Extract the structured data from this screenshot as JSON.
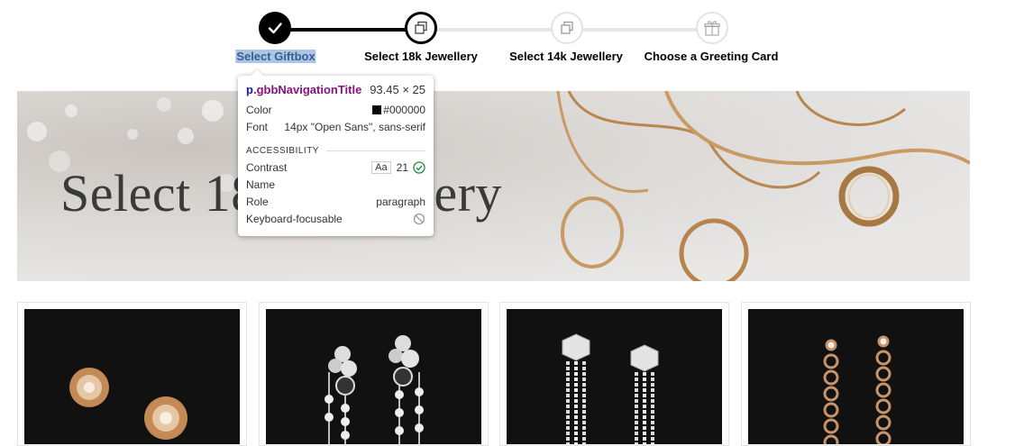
{
  "stepper": {
    "steps": [
      {
        "label": "Select Giftbox",
        "state": "done",
        "icon": "checkmark-icon"
      },
      {
        "label": "Select 18k Jewellery",
        "state": "current",
        "icon": "copy-icon"
      },
      {
        "label": "Select 14k Jewellery",
        "state": "pending",
        "icon": "copy-icon"
      },
      {
        "label": "Choose a Greeting Card",
        "state": "pending",
        "icon": "gift-icon"
      }
    ]
  },
  "banner": {
    "title": "Select 18k Jewellery"
  },
  "products": [
    {
      "name": "rose-gold rose earrings"
    },
    {
      "name": "onyx diamond drop earrings"
    },
    {
      "name": "diamond tassel earrings"
    },
    {
      "name": "rose-gold chain drop earrings"
    }
  ],
  "tooltip": {
    "element_tag": "p",
    "element_class": ".gbbNavigationTitle",
    "size": "93.45 × 25",
    "color_label": "Color",
    "color_value": "#000000",
    "font_label": "Font",
    "font_value": "14px \"Open Sans\", sans-serif",
    "accessibility_heading": "ACCESSIBILITY",
    "contrast_label": "Contrast",
    "contrast_badge": "Aa",
    "contrast_value": "21",
    "name_label": "Name",
    "role_label": "Role",
    "role_value": "paragraph",
    "focusable_label": "Keyboard-focusable"
  },
  "colors": {
    "done": "#000000",
    "pending_track": "#e6e6e6",
    "selection_highlight": "#a9c6e8",
    "pass_green": "#1e8e3e"
  }
}
